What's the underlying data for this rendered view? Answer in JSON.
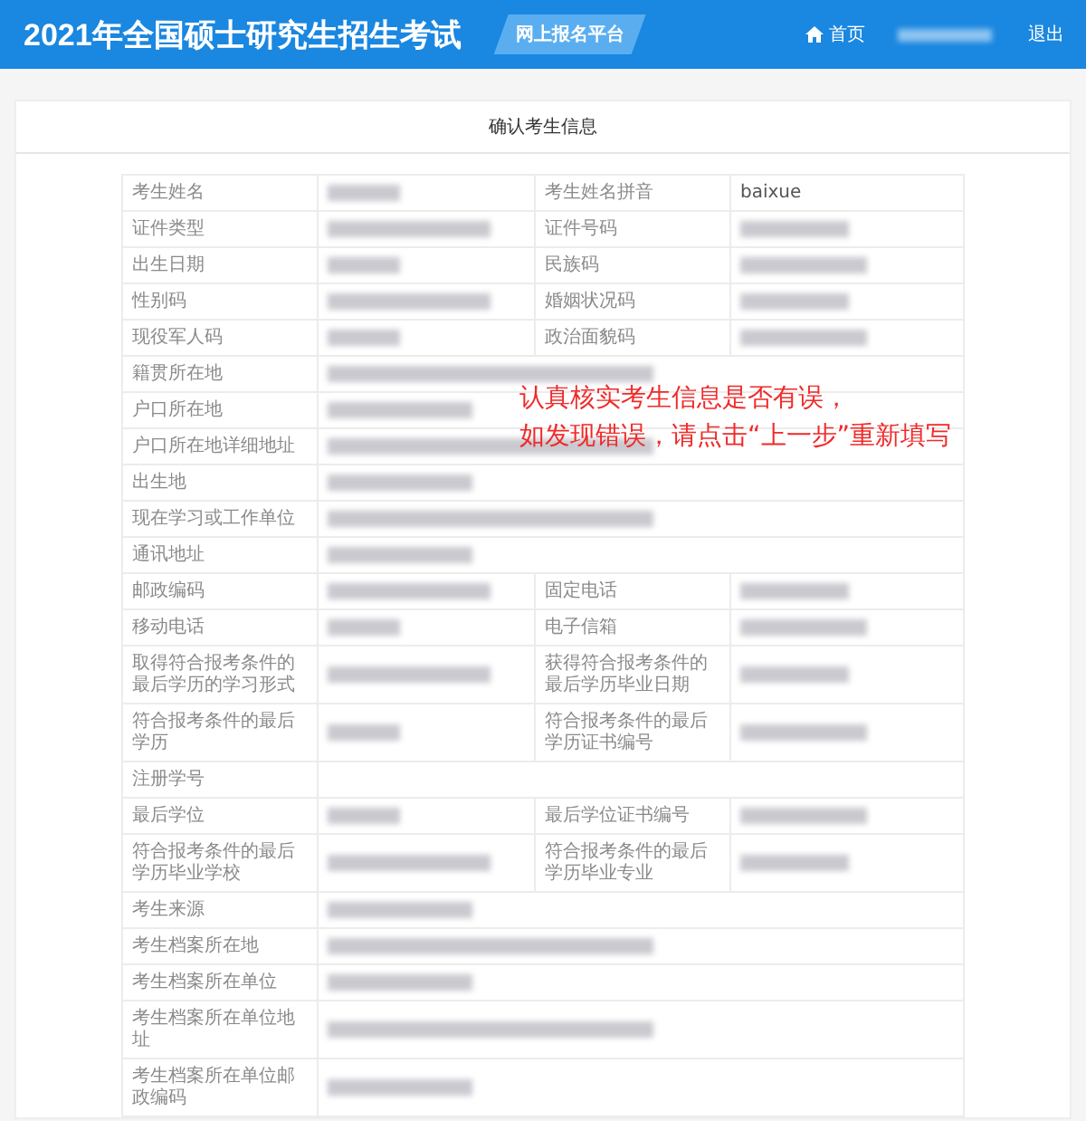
{
  "header": {
    "title": "2021年全国硕士研究生招生考试",
    "badge": "网上报名平台",
    "home_link": "首页",
    "user_redacted": true,
    "logout": "退出"
  },
  "panel": {
    "title": "确认考生信息",
    "rows": [
      {
        "fields": [
          {
            "label": "考生姓名",
            "redacted": true
          },
          {
            "label": "考生姓名拼音",
            "redacted": false,
            "value": "baixue"
          }
        ]
      },
      {
        "fields": [
          {
            "label": "证件类型",
            "redacted": true
          },
          {
            "label": "证件号码",
            "redacted": true
          }
        ]
      },
      {
        "fields": [
          {
            "label": "出生日期",
            "redacted": true
          },
          {
            "label": "民族码",
            "redacted": true
          }
        ]
      },
      {
        "fields": [
          {
            "label": "性别码",
            "redacted": true
          },
          {
            "label": "婚姻状况码",
            "redacted": true
          }
        ]
      },
      {
        "fields": [
          {
            "label": "现役军人码",
            "redacted": true
          },
          {
            "label": "政治面貌码",
            "redacted": true
          }
        ]
      },
      {
        "fields": [
          {
            "label": "籍贯所在地",
            "redacted": true
          }
        ]
      },
      {
        "fields": [
          {
            "label": "户口所在地",
            "redacted": true
          }
        ]
      },
      {
        "fields": [
          {
            "label": "户口所在地详细地址",
            "redacted": true
          }
        ]
      },
      {
        "fields": [
          {
            "label": "出生地",
            "redacted": true
          }
        ]
      },
      {
        "fields": [
          {
            "label": "现在学习或工作单位",
            "redacted": true
          }
        ]
      },
      {
        "fields": [
          {
            "label": "通讯地址",
            "redacted": true
          }
        ]
      },
      {
        "fields": [
          {
            "label": "邮政编码",
            "redacted": true
          },
          {
            "label": "固定电话",
            "redacted": true
          }
        ]
      },
      {
        "fields": [
          {
            "label": "移动电话",
            "redacted": true
          },
          {
            "label": "电子信箱",
            "redacted": true
          }
        ]
      },
      {
        "fields": [
          {
            "label": "取得符合报考条件的最后学历的学习形式",
            "redacted": true
          },
          {
            "label": "获得符合报考条件的最后学历毕业日期",
            "redacted": true
          }
        ]
      },
      {
        "fields": [
          {
            "label": "符合报考条件的最后学历",
            "redacted": true
          },
          {
            "label": "符合报考条件的最后学历证书编号",
            "redacted": true
          }
        ]
      },
      {
        "fields": [
          {
            "label": "注册学号",
            "redacted": false
          }
        ]
      },
      {
        "fields": [
          {
            "label": "最后学位",
            "redacted": true
          },
          {
            "label": "最后学位证书编号",
            "redacted": true
          }
        ]
      },
      {
        "fields": [
          {
            "label": "符合报考条件的最后学历毕业学校",
            "redacted": true
          },
          {
            "label": "符合报考条件的最后学历毕业专业",
            "redacted": true
          }
        ]
      },
      {
        "fields": [
          {
            "label": "考生来源",
            "redacted": true
          }
        ]
      },
      {
        "fields": [
          {
            "label": "考生档案所在地",
            "redacted": true
          }
        ]
      },
      {
        "fields": [
          {
            "label": "考生档案所在单位",
            "redacted": true
          }
        ]
      },
      {
        "fields": [
          {
            "label": "考生档案所在单位地址",
            "redacted": true
          }
        ]
      },
      {
        "fields": [
          {
            "label": "考生档案所在单位邮政编码",
            "redacted": true
          }
        ]
      }
    ]
  },
  "annotation": {
    "lines": [
      "认真核实考生信息是否有误，",
      "如发现错误，请点击“上一步”重新填写"
    ]
  }
}
